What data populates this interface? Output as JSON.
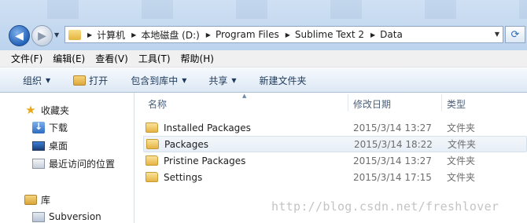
{
  "address_bar": {
    "crumbs": [
      "计算机",
      "本地磁盘 (D:)",
      "Program Files",
      "Sublime Text 2",
      "Data"
    ]
  },
  "menu": [
    "文件(F)",
    "编辑(E)",
    "查看(V)",
    "工具(T)",
    "帮助(H)"
  ],
  "commands": {
    "organize": "组织",
    "open": "打开",
    "include_in_library": "包含到库中",
    "share": "共享",
    "new_folder": "新建文件夹"
  },
  "nav_pane": {
    "favorites": "收藏夹",
    "downloads": "下载",
    "desktop": "桌面",
    "recent": "最近访问的位置",
    "libraries": "库",
    "subversion": "Subversion"
  },
  "file_list": {
    "columns": {
      "name": "名称",
      "date": "修改日期",
      "type": "类型"
    },
    "rows": [
      {
        "name": "Installed Packages",
        "date": "2015/3/14 13:27",
        "type": "文件夹"
      },
      {
        "name": "Packages",
        "date": "2015/3/14 18:22",
        "type": "文件夹"
      },
      {
        "name": "Pristine Packages",
        "date": "2015/3/14 13:27",
        "type": "文件夹"
      },
      {
        "name": "Settings",
        "date": "2015/3/14 17:15",
        "type": "文件夹"
      }
    ]
  },
  "watermark": "http://blog.csdn.net/freshlover"
}
